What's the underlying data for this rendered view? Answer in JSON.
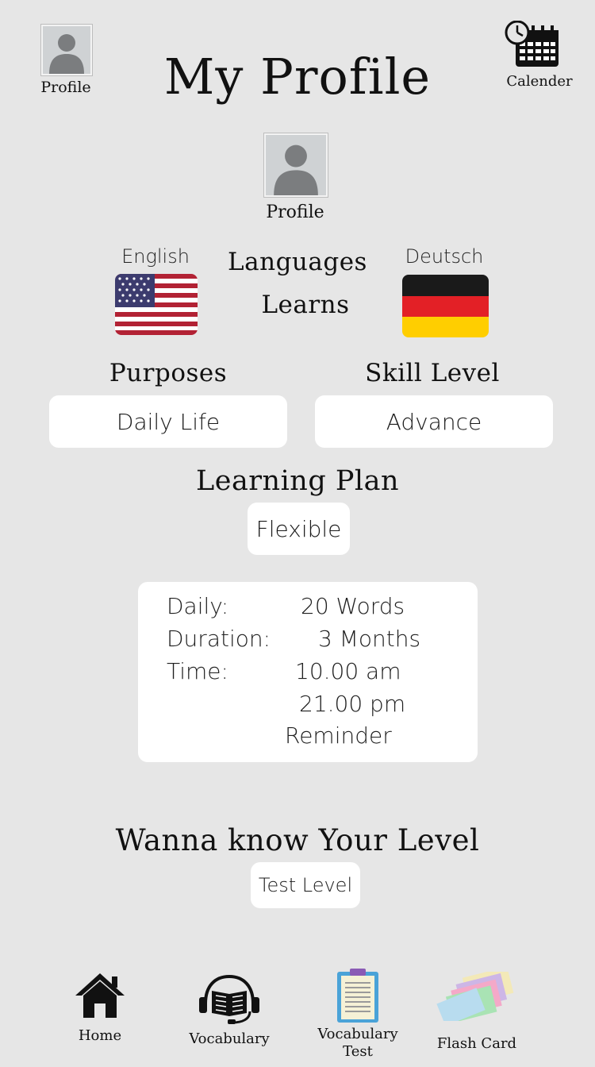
{
  "header": {
    "title": "My Profile",
    "profile_label": "Profile",
    "calendar_label": "Calender"
  },
  "user": {
    "avatar_label": "Profile"
  },
  "languages": {
    "native": "English",
    "heading_line1": "Languages",
    "heading_line2": "Learns",
    "target": "Deutsch"
  },
  "purposes": {
    "title": "Purposes",
    "value": "Daily Life"
  },
  "skill": {
    "title": "Skill Level",
    "value": "Advance"
  },
  "plan": {
    "title": "Learning Plan",
    "mode": "Flexible",
    "daily_label": "Daily:",
    "daily_value": "20 Words",
    "duration_label": "Duration:",
    "duration_value": "3 Months",
    "time_label": "Time:",
    "time_1": "10.00 am",
    "time_2": "21.00 pm",
    "reminder": "Reminder"
  },
  "level": {
    "title": "Wanna know Your Level",
    "button": "Test Level"
  },
  "nav": {
    "home": "Home",
    "vocabulary": "Vocabulary",
    "vocab_test_1": "Vocabulary",
    "vocab_test_2": "Test",
    "flash_card": "Flash Card"
  }
}
